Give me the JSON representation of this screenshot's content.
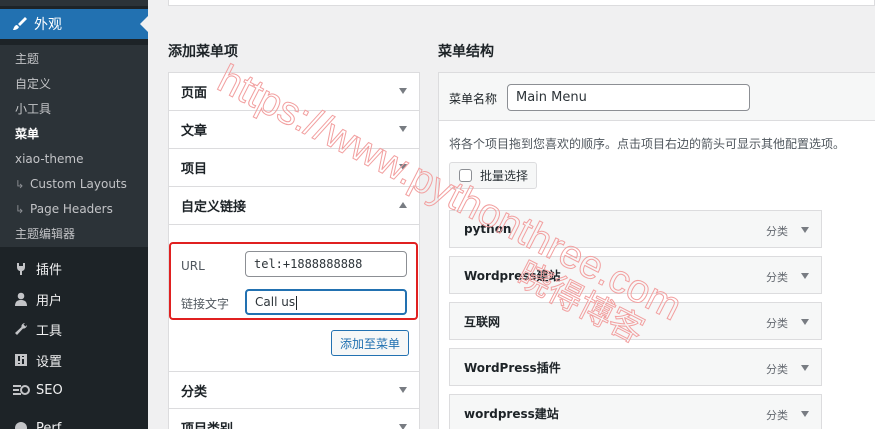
{
  "sidebar": {
    "active_section": {
      "label": "外观",
      "icon": "paintbrush-icon"
    },
    "submenu": [
      {
        "label": "主题",
        "tree": false
      },
      {
        "label": "自定义",
        "tree": false
      },
      {
        "label": "小工具",
        "tree": false
      },
      {
        "label": "菜单",
        "tree": false,
        "current": true
      },
      {
        "label": "xiao-theme",
        "tree": false
      },
      {
        "label": "Custom Layouts",
        "tree": true
      },
      {
        "label": "Page Headers",
        "tree": true
      },
      {
        "label": "主题编辑器",
        "tree": false
      }
    ],
    "items": [
      {
        "label": "插件",
        "icon": "plugin-icon"
      },
      {
        "label": "用户",
        "icon": "user-icon"
      },
      {
        "label": "工具",
        "icon": "wrench-icon"
      },
      {
        "label": "设置",
        "icon": "settings-icon"
      },
      {
        "label": "SEO",
        "icon": "seo-icon"
      },
      {
        "label": "Perf",
        "icon": "performance-icon"
      }
    ],
    "tree_glyph": "↳"
  },
  "add_items": {
    "title": "添加菜单项",
    "sections": [
      "页面",
      "文章",
      "项目",
      "自定义链接",
      "分类",
      "项目类别"
    ],
    "custom_link": {
      "url_label": "URL",
      "url_value": "tel:+1888888888",
      "text_label": "链接文字",
      "text_value": "Call us",
      "add_button": "添加至菜单"
    }
  },
  "structure": {
    "title": "菜单结构",
    "name_label": "菜单名称",
    "name_value": "Main Menu",
    "instructions": "将各个项目拖到您喜欢的顺序。点击项目右边的箭头可显示其他配置选项。",
    "bulk_select": "批量选择",
    "items": [
      {
        "label": "python",
        "type": "分类"
      },
      {
        "label": "Wordpress建站",
        "type": "分类"
      },
      {
        "label": "互联网",
        "type": "分类"
      },
      {
        "label": "WordPress插件",
        "type": "分类"
      },
      {
        "label": "wordpress建站",
        "type": "分类"
      }
    ]
  },
  "watermark": {
    "url": "https://www.pythonthree.com",
    "brand": "晓得博客",
    "color": "#f2a0a0"
  },
  "colors": {
    "sidebar_bg": "#1d2327",
    "submenu_bg": "#2c3338",
    "accent": "#2271b1",
    "highlight_border": "#e02020"
  }
}
